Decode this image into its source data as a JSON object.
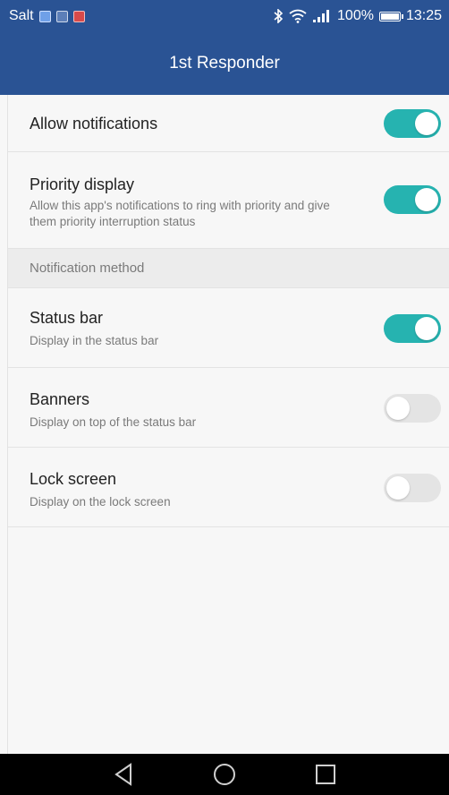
{
  "status_bar": {
    "carrier": "Salt",
    "battery": "100%",
    "time": "13:25",
    "icons": [
      "image-icon",
      "gallery-icon",
      "warning-icon",
      "bluetooth-icon",
      "wifi-icon",
      "signal-icon",
      "battery-icon"
    ]
  },
  "app_bar": {
    "title": "1st Responder"
  },
  "settings": {
    "allow_notifications": {
      "title": "Allow notifications",
      "enabled": true
    },
    "priority_display": {
      "title": "Priority display",
      "description": "Allow this app's notifications to ring with priority and give them priority interruption status",
      "enabled": true
    },
    "section_header": "Notification method",
    "status_bar": {
      "title": "Status bar",
      "description": "Display in the status bar",
      "enabled": true
    },
    "banners": {
      "title": "Banners",
      "description": "Display on top of the status bar",
      "enabled": false
    },
    "lock_screen": {
      "title": "Lock screen",
      "description": "Display on the lock screen",
      "enabled": false
    }
  },
  "colors": {
    "header": "#2a5394",
    "toggle_on": "#26b3b0",
    "toggle_off": "#e4e4e4"
  },
  "nav_bar": {
    "icons": [
      "back-icon",
      "home-icon",
      "recents-icon"
    ]
  }
}
